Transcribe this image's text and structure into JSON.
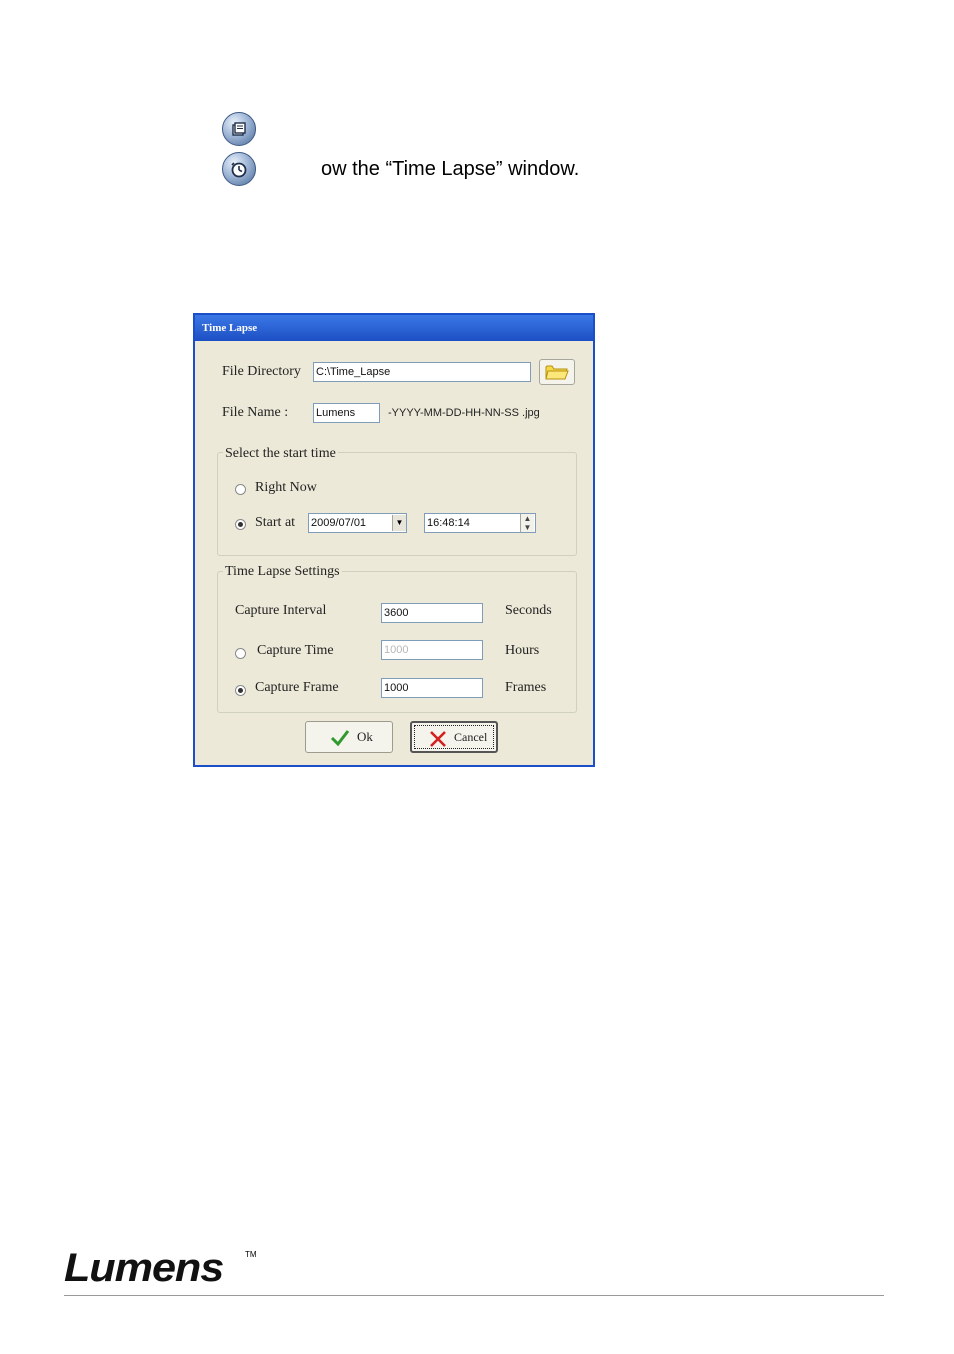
{
  "intro": {
    "text": "ow the “Time Lapse” window."
  },
  "dialog": {
    "title": "Time Lapse",
    "file_directory_label": "File Directory",
    "file_directory_value": "C:\\Time_Lapse",
    "file_name_label": "File Name :",
    "file_name_value": "Lumens",
    "file_name_suffix": "-YYYY-MM-DD-HH-NN-SS .jpg",
    "start_group": {
      "title": "Select the start time",
      "right_now_label": "Right Now",
      "start_at_label": "Start at",
      "date_value": "2009/07/01",
      "time_value": "16:48:14",
      "selected": "start_at"
    },
    "settings_group": {
      "title": "Time Lapse Settings",
      "capture_interval_label": "Capture Interval",
      "capture_interval_value": "3600",
      "capture_interval_unit": "Seconds",
      "capture_time_label": "Capture Time",
      "capture_time_value": "1000",
      "capture_time_unit": "Hours",
      "capture_frame_label": "Capture Frame",
      "capture_frame_value": "1000",
      "capture_frame_unit": "Frames",
      "selected": "capture_frame"
    },
    "ok_label": "Ok",
    "cancel_label": "Cancel"
  },
  "footer": {
    "logo": "Lumens",
    "trademark": "TM"
  },
  "colors": {
    "titlebar": "#1d4fc4",
    "dialog_bg": "#ece9d8",
    "ok_check": "#2e9a2e",
    "cancel_x": "#d42020"
  }
}
